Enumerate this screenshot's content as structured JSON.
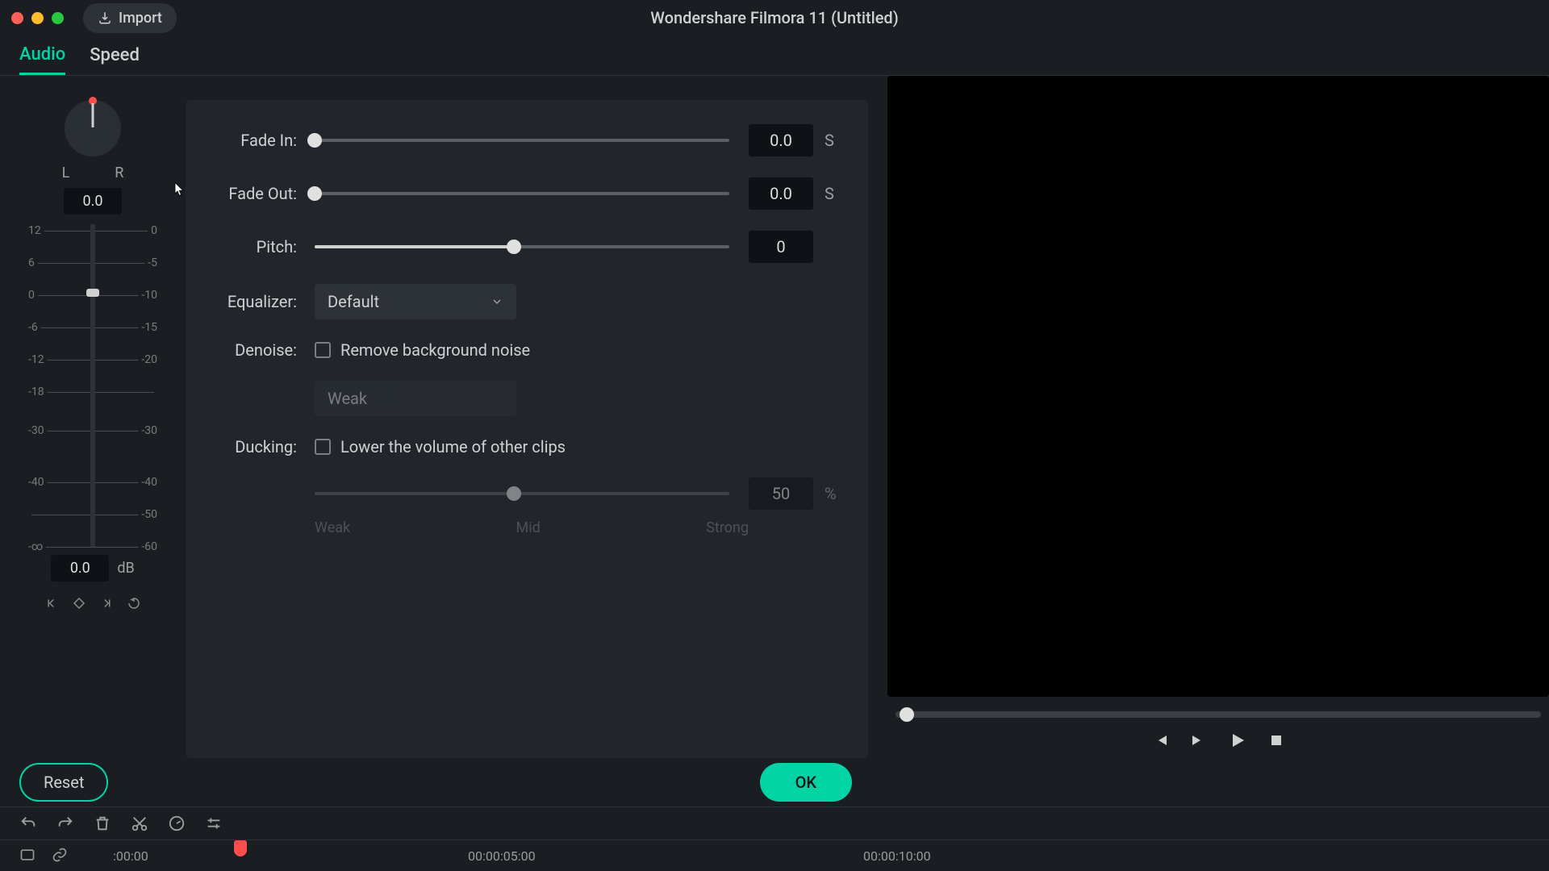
{
  "app_title": "Wondershare Filmora 11 (Untitled)",
  "import_label": "Import",
  "tabs": {
    "audio": "Audio",
    "speed": "Speed"
  },
  "pan": {
    "left": "L",
    "right": "R",
    "value": "0.0"
  },
  "volume": {
    "value": "0.0",
    "unit": "dB"
  },
  "vu_ticks_left": [
    "12",
    "6",
    "0",
    "-6",
    "-12",
    "-18",
    "",
    "-30",
    "",
    "-40",
    "",
    "-∞"
  ],
  "vu_ticks_right": [
    "0",
    "-5",
    "-10",
    "-15",
    "-20",
    "",
    "-30",
    "",
    "-40",
    "-50",
    "-60"
  ],
  "controls": {
    "fade_in": {
      "label": "Fade In:",
      "value": "0.0",
      "unit": "S",
      "pos": 0
    },
    "fade_out": {
      "label": "Fade Out:",
      "value": "0.0",
      "unit": "S",
      "pos": 0
    },
    "pitch": {
      "label": "Pitch:",
      "value": "0",
      "pos": 48
    },
    "equalizer": {
      "label": "Equalizer:",
      "value": "Default"
    },
    "denoise": {
      "label": "Denoise:",
      "checkbox": "Remove background noise",
      "strength": "Weak"
    },
    "ducking": {
      "label": "Ducking:",
      "checkbox": "Lower the volume of other clips",
      "value": "50",
      "unit": "%",
      "pos": 48,
      "legend": [
        "Weak",
        "Mid",
        "Strong"
      ]
    }
  },
  "buttons": {
    "reset": "Reset",
    "ok": "OK"
  },
  "timeline": {
    "t0": ":00:00",
    "t1": "00:00:05:00",
    "t2": "00:00:10:00"
  }
}
